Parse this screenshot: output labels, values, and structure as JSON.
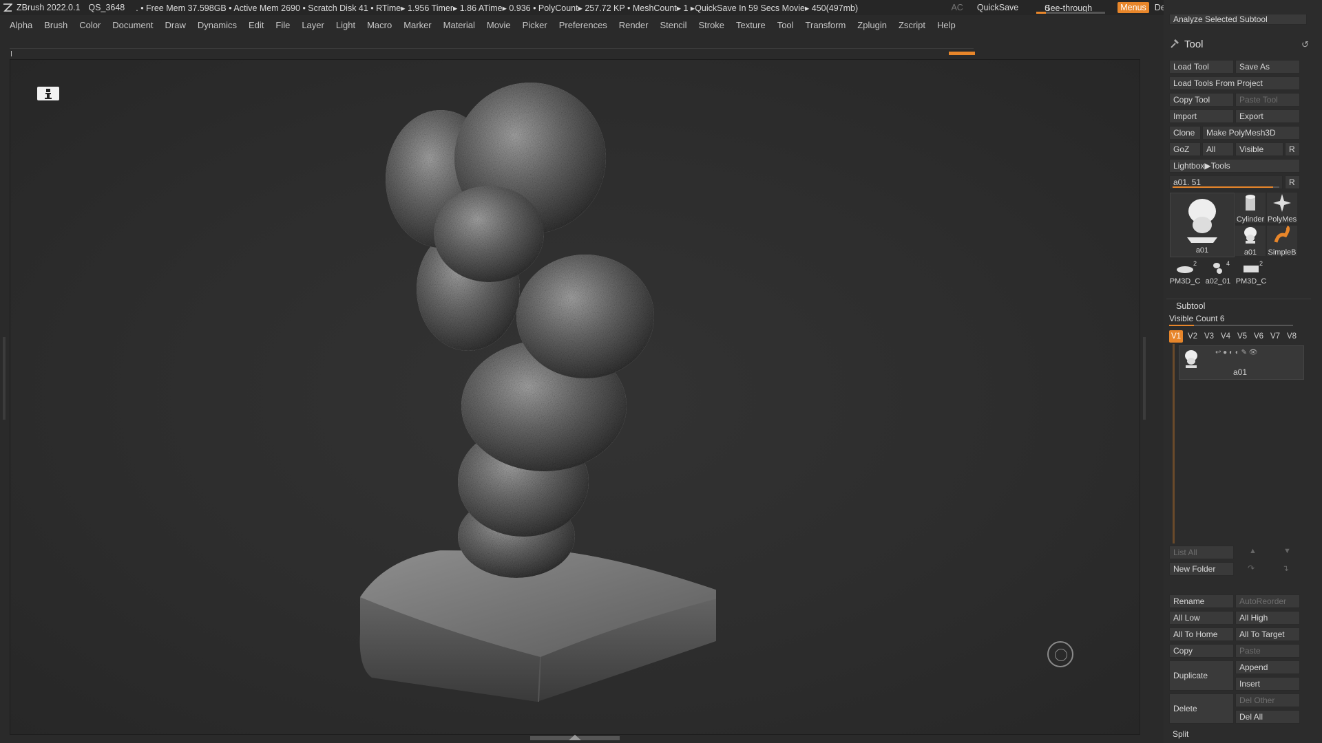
{
  "titlebar": {
    "app_title": "ZBrush 2022.0.1",
    "project": "QS_3648",
    "status": ". • Free Mem 37.598GB • Active Mem 2690 • Scratch Disk 41 •  RTime▸ 1.956 Timer▸ 1.86 ATime▸ 0.936 • PolyCount▸ 257.72 KP  • MeshCount▸ 1  ▸QuickSave In 59 Secs Movie▸ 450(497mb)",
    "ac": "AC",
    "quicksave": "QuickSave",
    "see_through_label": "See-through",
    "see_through_value": "0",
    "menus": "Menus",
    "default_zscript": "DefaultZScript"
  },
  "menubar": [
    "Alpha",
    "Brush",
    "Color",
    "Document",
    "Draw",
    "Dynamics",
    "Edit",
    "File",
    "Layer",
    "Light",
    "Macro",
    "Marker",
    "Material",
    "Movie",
    "Picker",
    "Preferences",
    "Render",
    "Stencil",
    "Stroke",
    "Texture",
    "Tool",
    "Transform",
    "Zplugin",
    "Zscript",
    "Help"
  ],
  "tool_panel": {
    "analyze_button": "Analyze Selected Subtool",
    "title": "Tool",
    "load_tool": "Load Tool",
    "save_as": "Save As",
    "load_from_project": "Load Tools From Project",
    "copy_tool": "Copy Tool",
    "paste_tool": "Paste Tool",
    "import": "Import",
    "export": "Export",
    "clone": "Clone",
    "make_polymesh": "Make PolyMesh3D",
    "goz": "GoZ",
    "all": "All",
    "visible": "Visible",
    "r": "R",
    "lightbox": "Lightbox▶Tools",
    "tool_slider_label": "a01. 51",
    "tool_slider_fraction": 0.94,
    "main_thumb": "a01",
    "thumbs": [
      {
        "label": "Cylinder",
        "badge": ""
      },
      {
        "label": "PolyMes",
        "badge": ""
      },
      {
        "label": "a01",
        "badge": ""
      },
      {
        "label": "SimpleB",
        "badge": ""
      },
      {
        "label": "PM3D_C",
        "badge": "2"
      },
      {
        "label": "a02_01",
        "badge": "4"
      },
      {
        "label": "PM3D_C",
        "badge": "2"
      }
    ]
  },
  "subtool": {
    "header": "Subtool",
    "visible_count_label": "Visible Count 6",
    "visible_count_fraction": 0.2,
    "tabs": [
      "V1",
      "V2",
      "V3",
      "V4",
      "V5",
      "V6",
      "V7",
      "V8"
    ],
    "active_tab": "V1",
    "item_name": "a01",
    "list_all": "List All",
    "new_folder": "New Folder",
    "rename": "Rename",
    "auto_reorder": "AutoReorder",
    "all_low": "All Low",
    "all_high": "All High",
    "all_to_home": "All To Home",
    "all_to_target": "All To Target",
    "copy": "Copy",
    "paste": "Paste",
    "duplicate": "Duplicate",
    "append": "Append",
    "insert": "Insert",
    "del_other": "Del Other",
    "delete": "Delete",
    "del_all": "Del All",
    "split": "Split"
  },
  "colors": {
    "accent": "#e8862a",
    "background": "#2a2a2a",
    "button": "#3a3a3a"
  }
}
